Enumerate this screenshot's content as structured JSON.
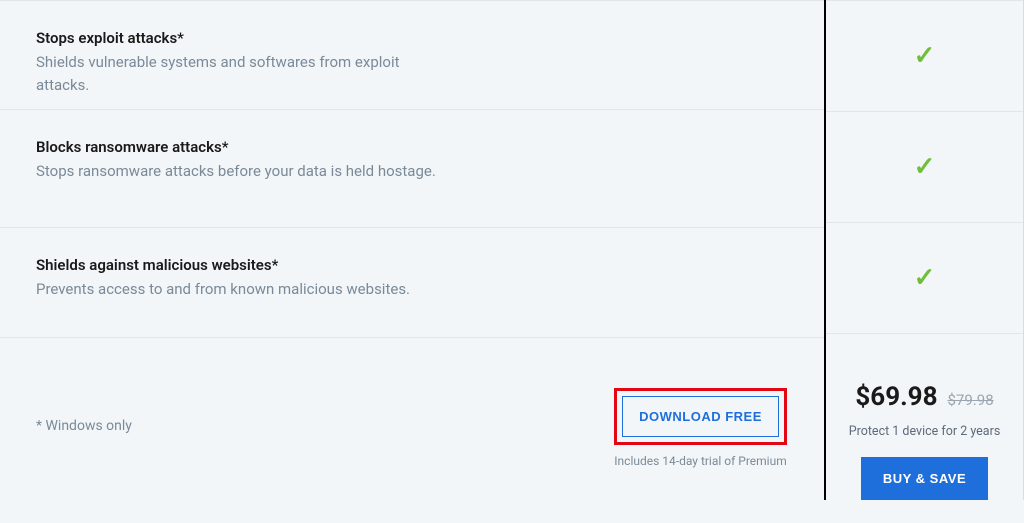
{
  "features": [
    {
      "title": "Stops exploit attacks*",
      "desc": "Shields vulnerable systems and softwares from exploit attacks.",
      "checked": true
    },
    {
      "title": "Blocks ransomware attacks*",
      "desc": "Stops ransomware attacks before your data is held hostage.",
      "checked": true
    },
    {
      "title": "Shields against malicious websites*",
      "desc": "Prevents access to and from known malicious websites.",
      "checked": true
    }
  ],
  "footer": {
    "note": "* Windows only",
    "download_label": "DOWNLOAD FREE",
    "download_sub": "Includes 14-day trial of Premium"
  },
  "pricing": {
    "price": "$69.98",
    "old_price": "$79.98",
    "desc": "Protect 1 device for 2 years",
    "buy_label": "BUY & SAVE"
  }
}
